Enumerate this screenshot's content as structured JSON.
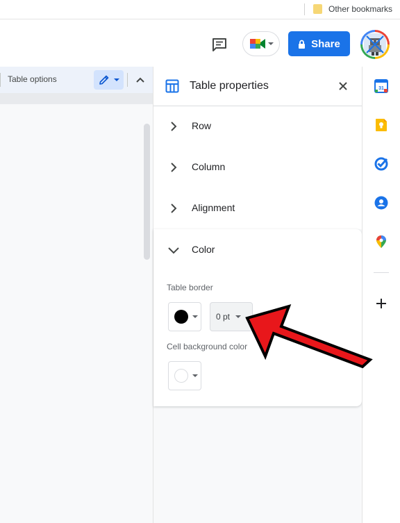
{
  "bookmarks": {
    "folder_label": "Other bookmarks"
  },
  "header": {
    "share_label": "Share"
  },
  "toolbar": {
    "table_options_label": "Table options"
  },
  "panel": {
    "title": "Table properties",
    "sections": [
      {
        "label": "Row",
        "expanded": false
      },
      {
        "label": "Column",
        "expanded": false
      },
      {
        "label": "Alignment",
        "expanded": false
      },
      {
        "label": "Color",
        "expanded": true
      }
    ],
    "color": {
      "table_border_label": "Table border",
      "border_color": "#000000",
      "border_weight": "0 pt",
      "cell_background_label": "Cell background color",
      "cell_background_color": "#ffffff"
    }
  },
  "colors": {
    "accent": "#1a73e8",
    "annotation_arrow": "#e8171b",
    "toolbar_bg": "#edf2fa"
  },
  "icons": [
    "comment-icon",
    "meet-icon",
    "lock-icon",
    "table-icon",
    "close-icon",
    "chevron-right-icon",
    "chevron-down-icon",
    "calendar-icon",
    "keep-icon",
    "tasks-icon",
    "contacts-icon",
    "maps-icon",
    "plus-icon"
  ],
  "sidebar": {
    "calendar_day": "31"
  }
}
